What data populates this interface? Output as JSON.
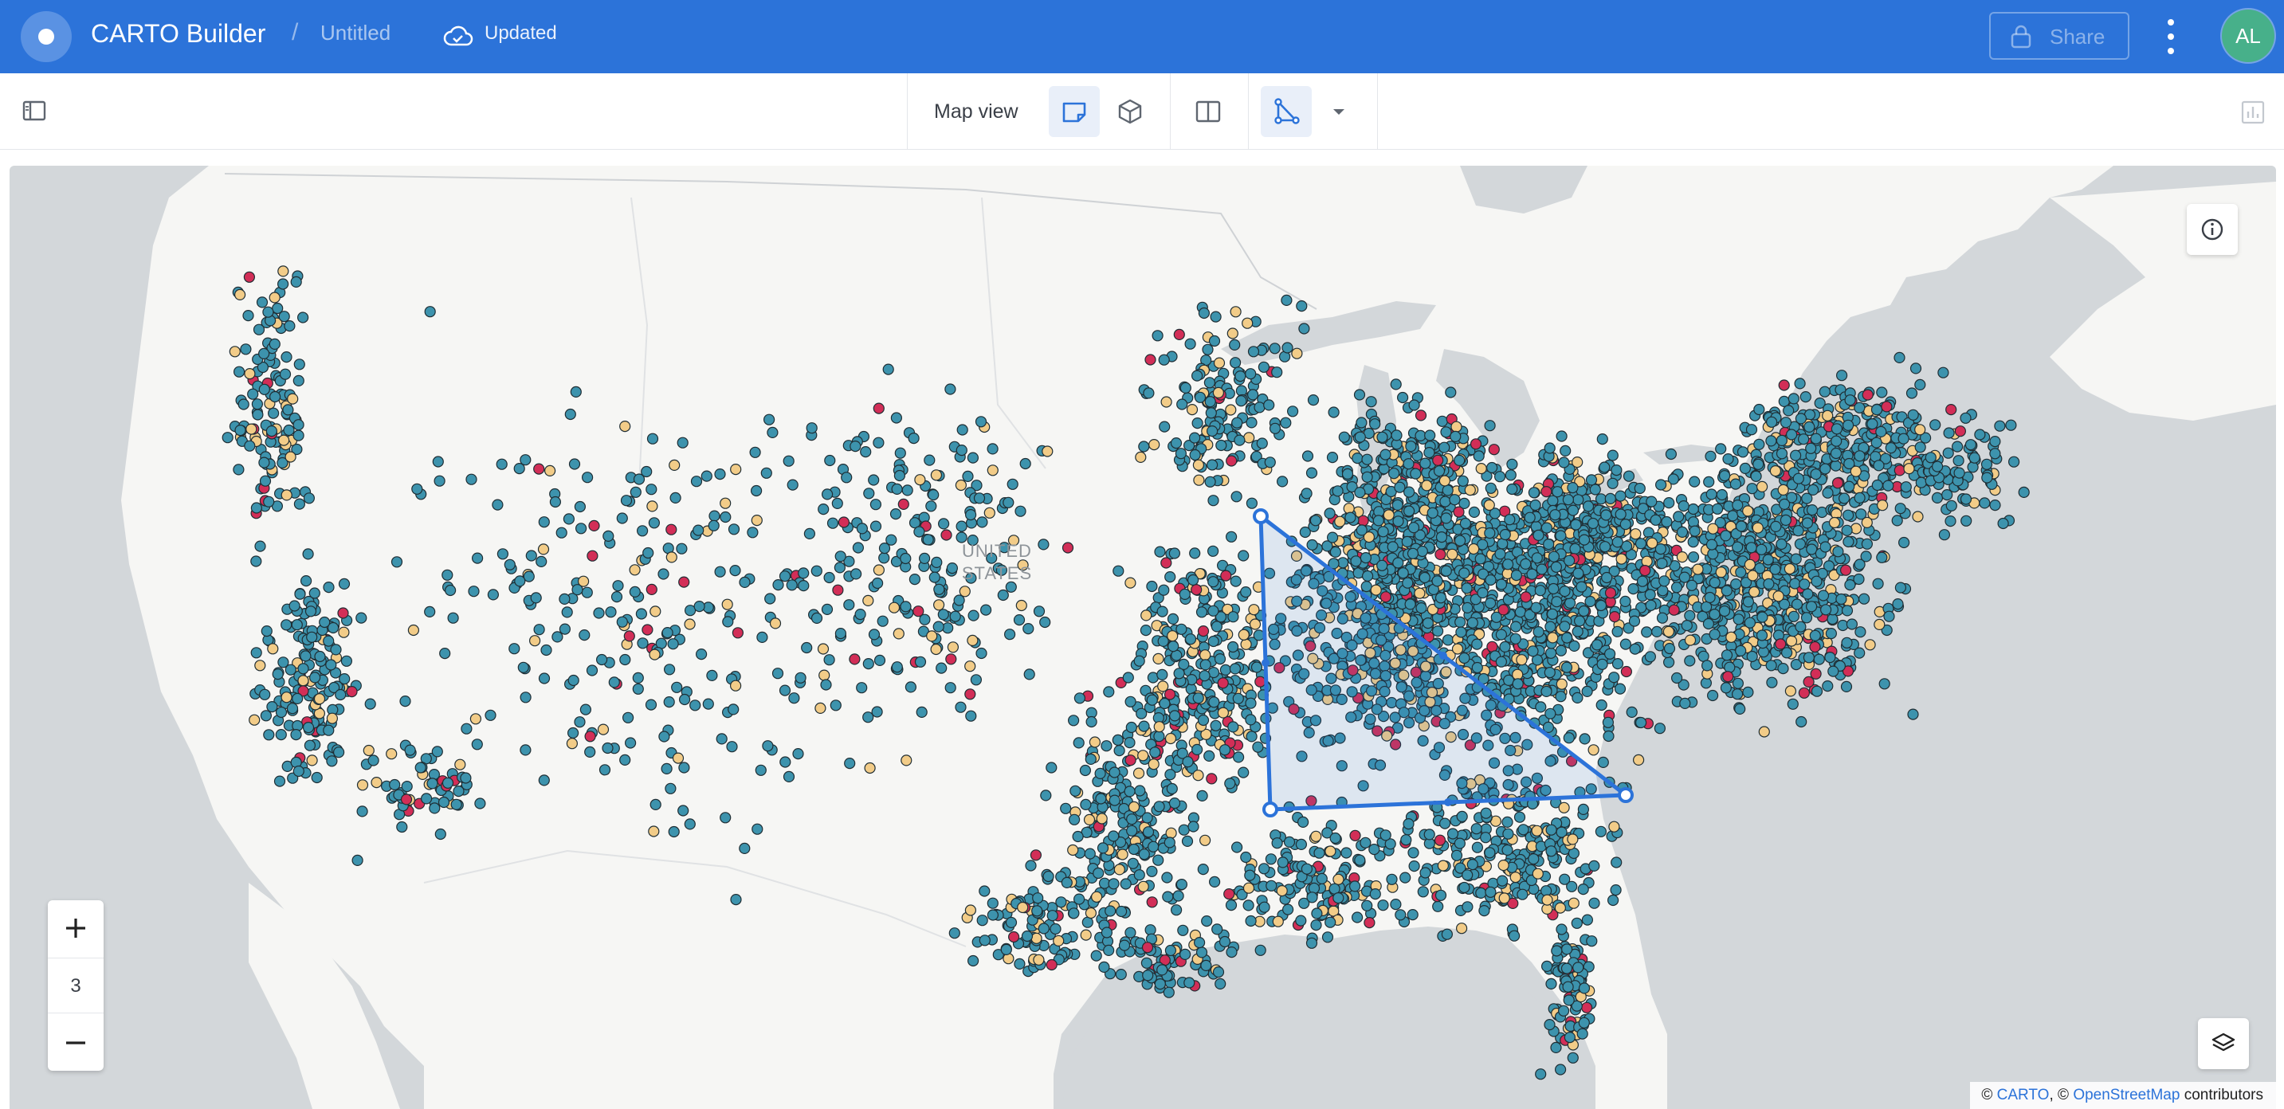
{
  "app": {
    "title": "CARTO Builder",
    "separator": "/",
    "map_name": "Untitled",
    "save_status": "Updated",
    "share_label": "Share",
    "avatar_initials": "AL",
    "brand_color": "#2c73d9"
  },
  "toolbar": {
    "map_view_label": "Map view",
    "icons": [
      "sidebar-toggle-icon",
      "2d-view-icon",
      "3d-view-icon",
      "split-view-icon",
      "draw-polygon-icon",
      "dropdown-caret-icon",
      "widgets-panel-icon"
    ],
    "active_view": "2d"
  },
  "map": {
    "country_label_line1": "UNITED",
    "country_label_line2": "STATES",
    "zoom_level": "3",
    "zoom_in_label": "+",
    "zoom_out_label": "−",
    "point_colors": {
      "primary": "#3d93ad",
      "secondary": "#f2cc88",
      "highlight": "#d22e57"
    },
    "attribution": {
      "prefix": "© ",
      "carto": "CARTO",
      "middle": ", © ",
      "osm": "OpenStreetMap",
      "suffix": " contributors"
    }
  }
}
